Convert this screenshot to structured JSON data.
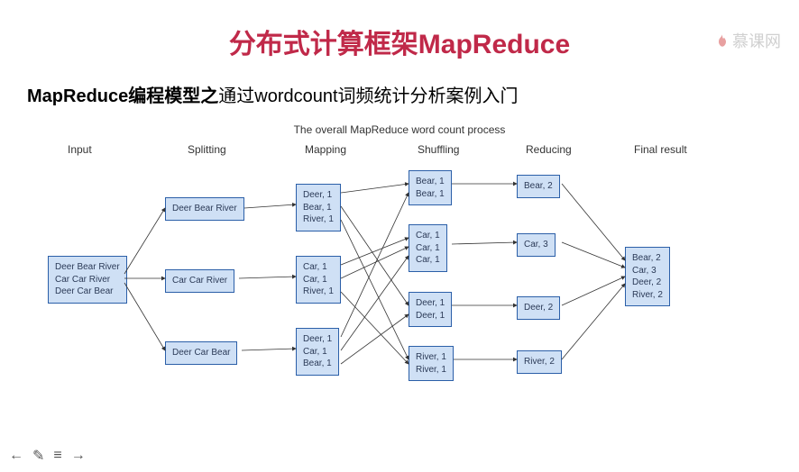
{
  "watermark": {
    "text": "慕课网"
  },
  "title": "分布式计算框架MapReduce",
  "subtitle_bold": "MapReduce编程模型之",
  "subtitle_tail": "通过wordcount词频统计分析案例入门",
  "diagram": {
    "title": "The overall MapReduce word count process",
    "columns": [
      "Input",
      "Splitting",
      "Mapping",
      "Shuffling",
      "Reducing",
      "Final result"
    ],
    "input": {
      "lines": [
        "Deer Bear River",
        "Car Car River",
        "Deer Car Bear"
      ]
    },
    "splitting": [
      {
        "text": "Deer Bear River"
      },
      {
        "text": "Car Car River"
      },
      {
        "text": "Deer Car Bear"
      }
    ],
    "mapping": [
      {
        "lines": [
          "Deer, 1",
          "Bear, 1",
          "River, 1"
        ]
      },
      {
        "lines": [
          "Car, 1",
          "Car, 1",
          "River, 1"
        ]
      },
      {
        "lines": [
          "Deer, 1",
          "Car, 1",
          "Bear, 1"
        ]
      }
    ],
    "shuffling": [
      {
        "lines": [
          "Bear, 1",
          "Bear, 1"
        ]
      },
      {
        "lines": [
          "Car, 1",
          "Car, 1",
          "Car, 1"
        ]
      },
      {
        "lines": [
          "Deer, 1",
          "Deer, 1"
        ]
      },
      {
        "lines": [
          "River, 1",
          "River, 1"
        ]
      }
    ],
    "reducing": [
      {
        "text": "Bear, 2"
      },
      {
        "text": "Car, 3"
      },
      {
        "text": "Deer, 2"
      },
      {
        "text": "River, 2"
      }
    ],
    "final": {
      "lines": [
        "Bear, 2",
        "Car, 3",
        "Deer, 2",
        "River, 2"
      ]
    }
  },
  "toolbar": {
    "back": "←",
    "edit": "✎",
    "menu": "≡",
    "forward": "→"
  }
}
